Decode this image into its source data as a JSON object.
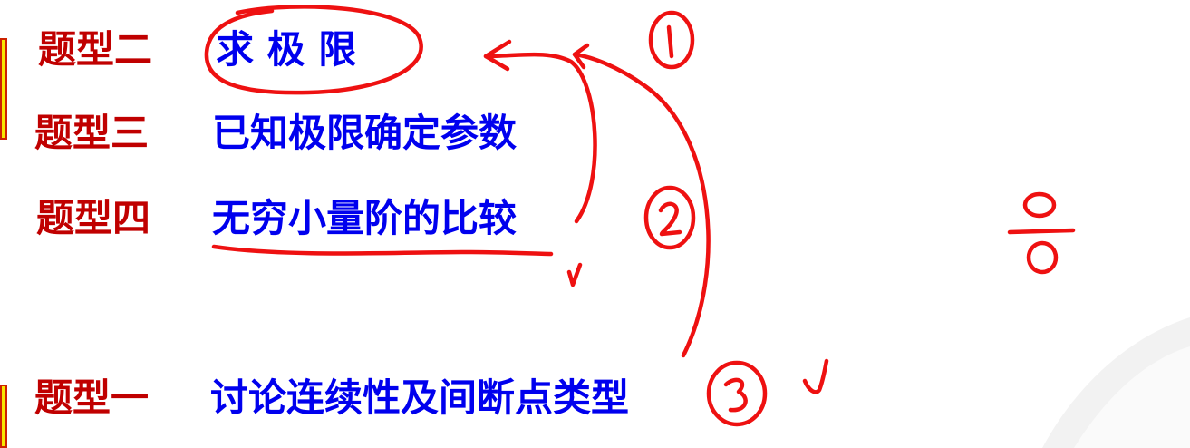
{
  "rows": [
    {
      "label": "题型二",
      "title": "求 极 限"
    },
    {
      "label": "题型三",
      "title": "已知极限确定参数"
    },
    {
      "label": "题型四",
      "title": "无穷小量阶的比较"
    },
    {
      "label": "题型一",
      "title": "讨论连续性及间断点类型"
    }
  ],
  "annotation_color": "#ee1111",
  "label_color": "#c00000",
  "title_color": "#0000ee",
  "marker_color": "#f7e600"
}
